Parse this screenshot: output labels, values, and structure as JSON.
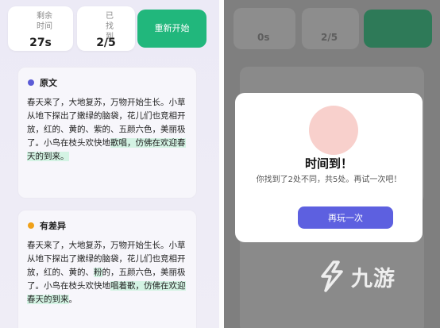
{
  "left": {
    "stats": {
      "time_label": "剩余时间",
      "time_value": "27s",
      "found_label": "已找到",
      "found_value": "2/5"
    },
    "restart_label": "重新开始",
    "original": {
      "title": "原文",
      "text_plain": "春天来了，大地复苏，万物开始生长。小草从地下探出了嫩绿的脑袋，花儿们也竞相开放，红的、黄的、紫的、五颜六色，美丽极了。小鸟在枝头欢快地",
      "text_highlight": "歌唱，仿佛在欢迎春天的到来。"
    },
    "modified": {
      "title": "有差异",
      "seg1": "春天来了，大地复苏，万物开始生长。小草从地下探出了嫩绿的脑袋，花儿们也竞相开放，红的、黄的、",
      "seg2_hl": "粉",
      "seg3": "的，五颜六色，美丽极了。小鸟在枝头欢快地",
      "seg4_hl": "唱着歌，仿佛在欢迎春天的到来",
      "seg5": "。"
    }
  },
  "right": {
    "bg_stats": {
      "time_value": "0s",
      "found_value": "2/5"
    },
    "modal": {
      "title": "时间到！",
      "message": "你找到了2处不同，共5处。再试一次吧！",
      "button_label": "再玩一次"
    },
    "watermark": {
      "text": "九游",
      "icon": "jiuyou-logo-icon"
    }
  },
  "colors": {
    "accent_green": "#21b77c",
    "accent_blue": "#5d60e0",
    "highlight": "#d4f3e4",
    "overlay": "#7f7f7f"
  }
}
